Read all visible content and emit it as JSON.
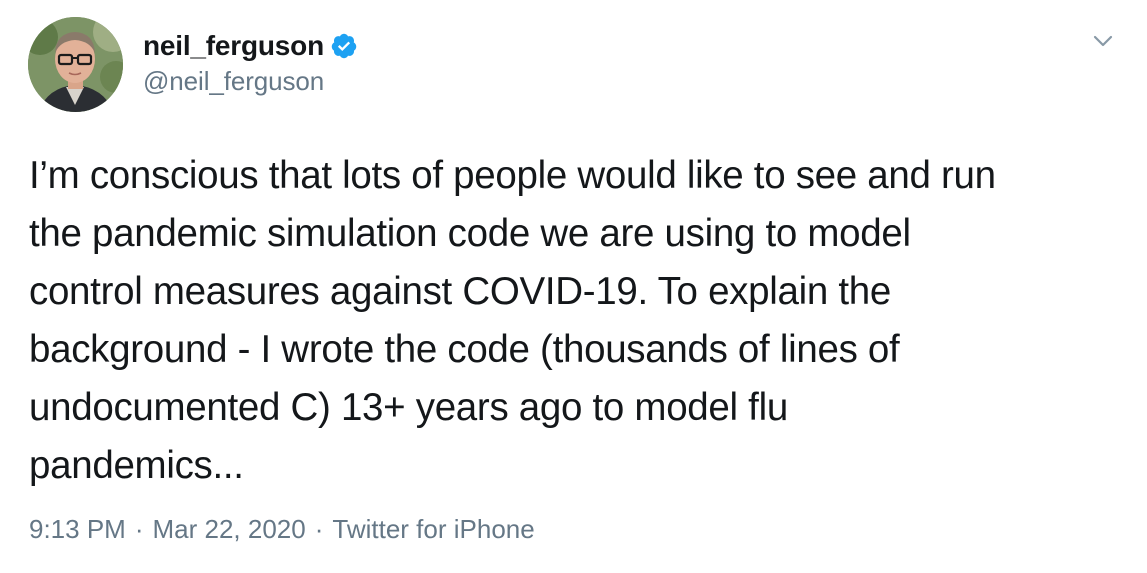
{
  "author": {
    "display_name": "neil_ferguson",
    "handle": "@neil_ferguson",
    "verified": true,
    "avatar_icon": "profile-photo-avatar"
  },
  "tweet": {
    "text": "I’m conscious that lots of people would like to see and run\nthe pandemic simulation code we are using to model\ncontrol measures against COVID-19.  To explain the\nbackground - I wrote the code (thousands of lines of\nundocumented C) 13+ years ago to model flu\npandemics...",
    "time": "9:13 PM",
    "date": "Mar 22, 2020",
    "separator": "·",
    "source": "Twitter for iPhone"
  },
  "icons": {
    "verified": "verified-badge-icon",
    "menu": "chevron-down-icon"
  },
  "colors": {
    "text_primary": "#14171a",
    "text_secondary": "#657786",
    "verified_blue": "#1da1f2"
  }
}
